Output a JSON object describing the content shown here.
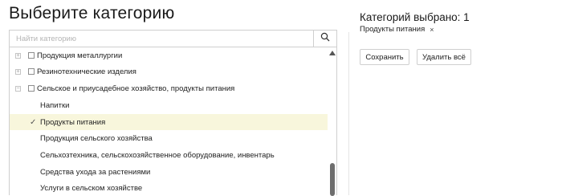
{
  "page": {
    "title": "Выберите категорию"
  },
  "search": {
    "placeholder": "Найти категорию",
    "value": "",
    "icon": "search-icon"
  },
  "tree": {
    "items": [
      {
        "label": "Продукция металлургии",
        "level": 1,
        "expanded": false,
        "checked": false,
        "toggle": "+"
      },
      {
        "label": "Резинотехнические изделия",
        "level": 1,
        "expanded": false,
        "checked": false,
        "toggle": "+"
      },
      {
        "label": "Сельское и приусадебное хозяйство, продукты питания",
        "level": 1,
        "expanded": true,
        "checked": false,
        "toggle": "−"
      },
      {
        "label": "Напитки",
        "level": 2,
        "selected": false
      },
      {
        "label": "Продукты питания",
        "level": 2,
        "selected": true,
        "mark": "✓"
      },
      {
        "label": "Продукция сельского хозяйства",
        "level": 2,
        "selected": false
      },
      {
        "label": "Сельхозтехника, сельскохозяйственное оборудование, инвентарь",
        "level": 2,
        "selected": false
      },
      {
        "label": "Средства ухода за растениями",
        "level": 2,
        "selected": false
      },
      {
        "label": "Услуги в сельском хозяйстве",
        "level": 2,
        "selected": false
      }
    ]
  },
  "summary": {
    "count_text": "Категорий выбрано: 1",
    "chips": [
      {
        "label": "Продукты питания",
        "remove": "×"
      }
    ]
  },
  "actions": {
    "save_label": "Сохранить",
    "clear_label": "Удалить всё"
  },
  "colors": {
    "selected_row_bg": "#f8f6dc",
    "border": "#cfcfcf",
    "scroll_thumb": "#6e6e6e"
  }
}
